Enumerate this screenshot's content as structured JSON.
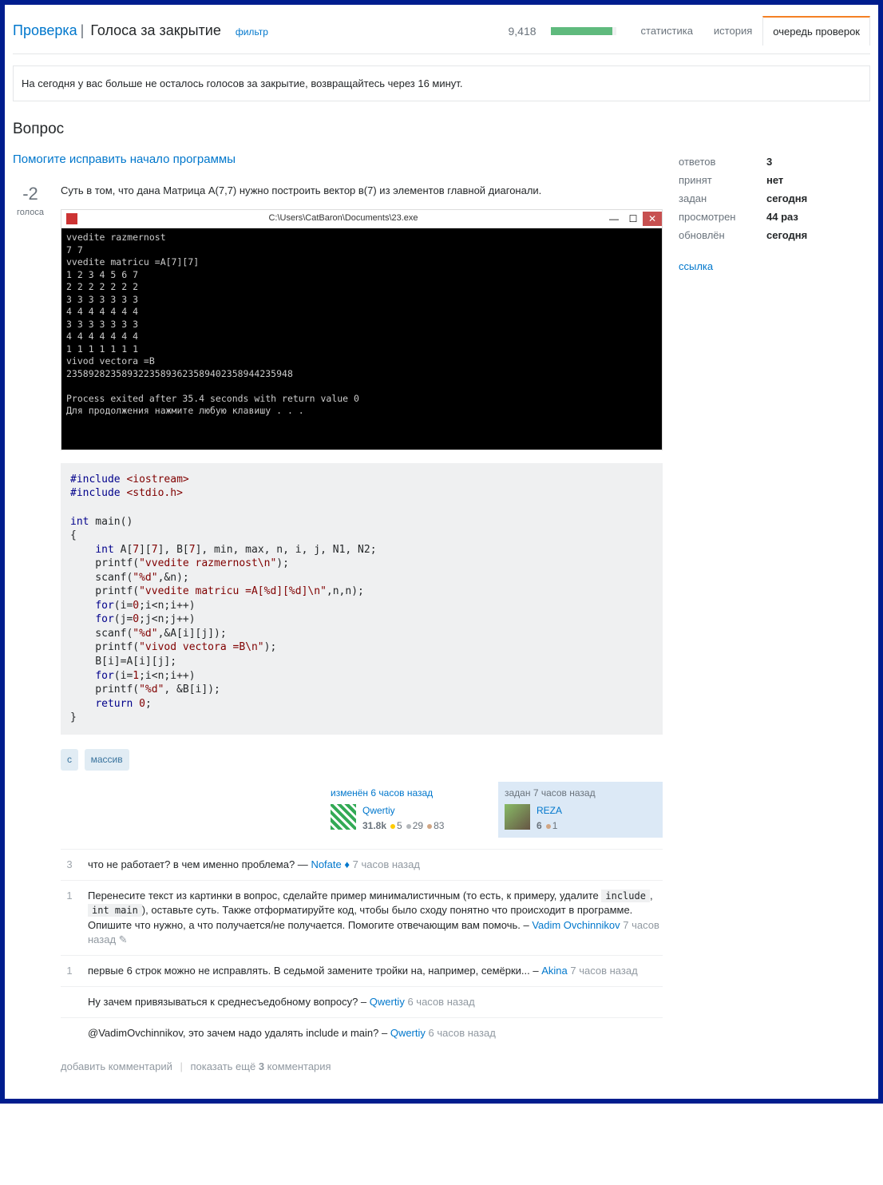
{
  "header": {
    "title": "Проверка",
    "sub": "|",
    "name": "Голоса за закрытие",
    "filter": "фильтр",
    "rep": "9,418",
    "progress": 95
  },
  "tabs": {
    "stats": "статистика",
    "history": "история",
    "queue": "очередь проверок"
  },
  "notice": "На сегодня у вас больше не осталось голосов за закрытие, возвращайтесь через 16 минут.",
  "section": "Вопрос",
  "question": {
    "link": "Помогите исправить начало программы",
    "score": "-2",
    "score_label": "голоса",
    "text": "Суть в том, что дана Матрица A(7,7) нужно построить вектор в(7) из элементов главной диагонали.",
    "img_title": "C:\\Users\\CatBaron\\Documents\\23.exe",
    "term": "vvedite razmernost\n7 7\nvvedite matricu =A[7][7]\n1 2 3 4 5 6 7\n2 2 2 2 2 2 2\n3 3 3 3 3 3 3\n4 4 4 4 4 4 4\n3 3 3 3 3 3 3\n4 4 4 4 4 4 4\n1 1 1 1 1 1 1\nvivod vectora =B\n23589282358932235893623589402358944235948\n\nProcess exited after 35.4 seconds with return value 0\nДля продолжения нажмите любую клавишу . . .",
    "tags": [
      "c",
      "массив"
    ],
    "edited": {
      "action": "изменён 6 часов назад",
      "user": "Qwertiy",
      "rep": "31.8k",
      "gold": "5",
      "silver": "29",
      "bronze": "83"
    },
    "asked": {
      "action": "задан 7 часов назад",
      "user": "REZA",
      "rep": "6",
      "bronze": "1"
    }
  },
  "stats": {
    "answers_l": "ответов",
    "answers_v": "3",
    "accepted_l": "принят",
    "accepted_v": "нет",
    "asked_l": "задан",
    "asked_v": "сегодня",
    "views_l": "просмотрен",
    "views_v": "44 раз",
    "active_l": "обновлён",
    "active_v": "сегодня",
    "link": "ссылка"
  },
  "comments": [
    {
      "v": "3",
      "text": "что не работает? в чем именно проблема? — ",
      "user": "Nofate",
      "mod": "♦",
      "time": "7 часов назад"
    },
    {
      "v": "1",
      "pre": "Перенесите текст из картинки в вопрос, сделайте пример минималистичным (то есть, к примеру, удалите ",
      "c1": "include",
      "mid": ", ",
      "c2": "int main",
      "post": "), оставьте суть. Также отформатируйте код, чтобы было сходу понятно что происходит в программе. Опишите что нужно, а что получается/не получается. Помогите отвечающим вам помочь. – ",
      "user": "Vadim Ovchinnikov",
      "time": "7 часов назад",
      "edit": "✎"
    },
    {
      "v": "1",
      "text": "первые 6 строк можно не исправлять. В седьмой замените тройки на, например, семёрки... – ",
      "user": "Akina",
      "time": "7 часов назад"
    },
    {
      "v": "",
      "text": "Ну зачем привязываться к среднесъедобному вопросу? – ",
      "user": "Qwertiy",
      "time": "6 часов назад"
    },
    {
      "v": "",
      "text": "@VadimOvchinnikov, это зачем надо удалять include и main? – ",
      "user": "Qwertiy",
      "time": "6 часов назад"
    }
  ],
  "actions": {
    "add": "добавить комментарий",
    "show_pre": "показать ещё ",
    "show_n": "3",
    "show_post": " комментария"
  }
}
